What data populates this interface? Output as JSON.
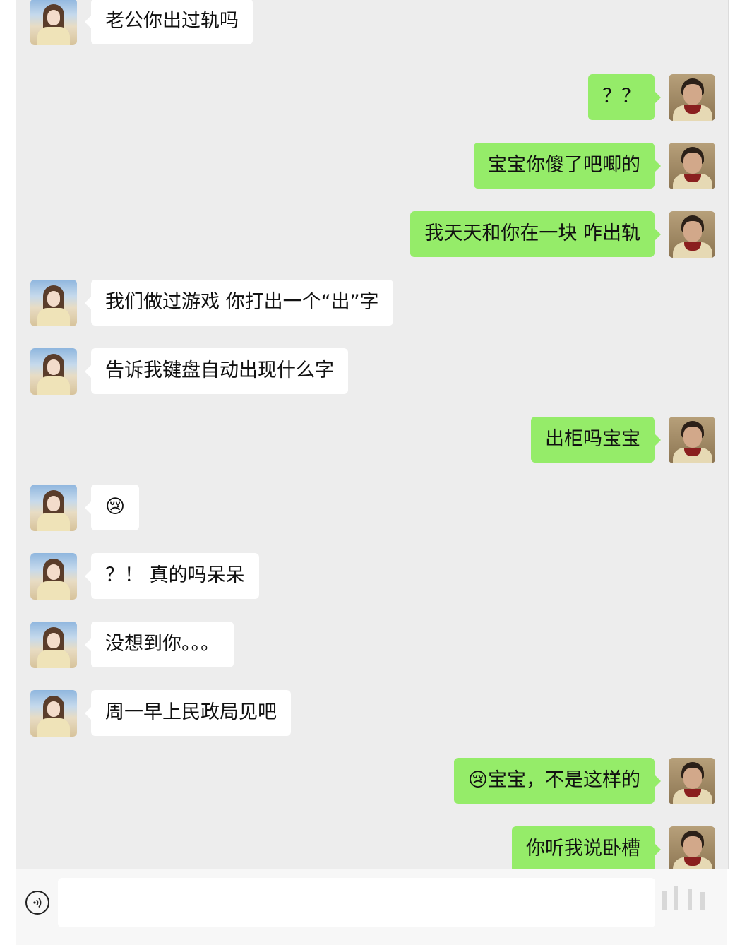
{
  "chat": {
    "messages": [
      {
        "side": "left",
        "sender": "her",
        "text": "老公你出过轨吗"
      },
      {
        "side": "right",
        "sender": "him",
        "text": "？？"
      },
      {
        "side": "right",
        "sender": "him",
        "text": "宝宝你傻了吧唧的"
      },
      {
        "side": "right",
        "sender": "him",
        "text": "我天天和你在一块 咋出轨"
      },
      {
        "side": "left",
        "sender": "her",
        "text": "我们做过游戏 你打出一个“出”字"
      },
      {
        "side": "left",
        "sender": "her",
        "text": "告诉我键盘自动出现什么字"
      },
      {
        "side": "right",
        "sender": "him",
        "text": "出柜吗宝宝"
      },
      {
        "side": "left",
        "sender": "her",
        "text": "😢"
      },
      {
        "side": "left",
        "sender": "her",
        "text": "？！ 真的吗呆呆"
      },
      {
        "side": "left",
        "sender": "her",
        "text": "没想到你。。。"
      },
      {
        "side": "left",
        "sender": "her",
        "text": "周一早上民政局见吧"
      },
      {
        "side": "right",
        "sender": "him",
        "text": "😢宝宝，不是这样的"
      },
      {
        "side": "right",
        "sender": "him",
        "text": "你听我说卧槽"
      }
    ]
  },
  "input_bar": {
    "voice_icon": "voice-input-icon",
    "text_value": ""
  },
  "colors": {
    "chat_background": "#ededed",
    "outgoing_bubble": "#95ec69",
    "incoming_bubble": "#ffffff"
  }
}
